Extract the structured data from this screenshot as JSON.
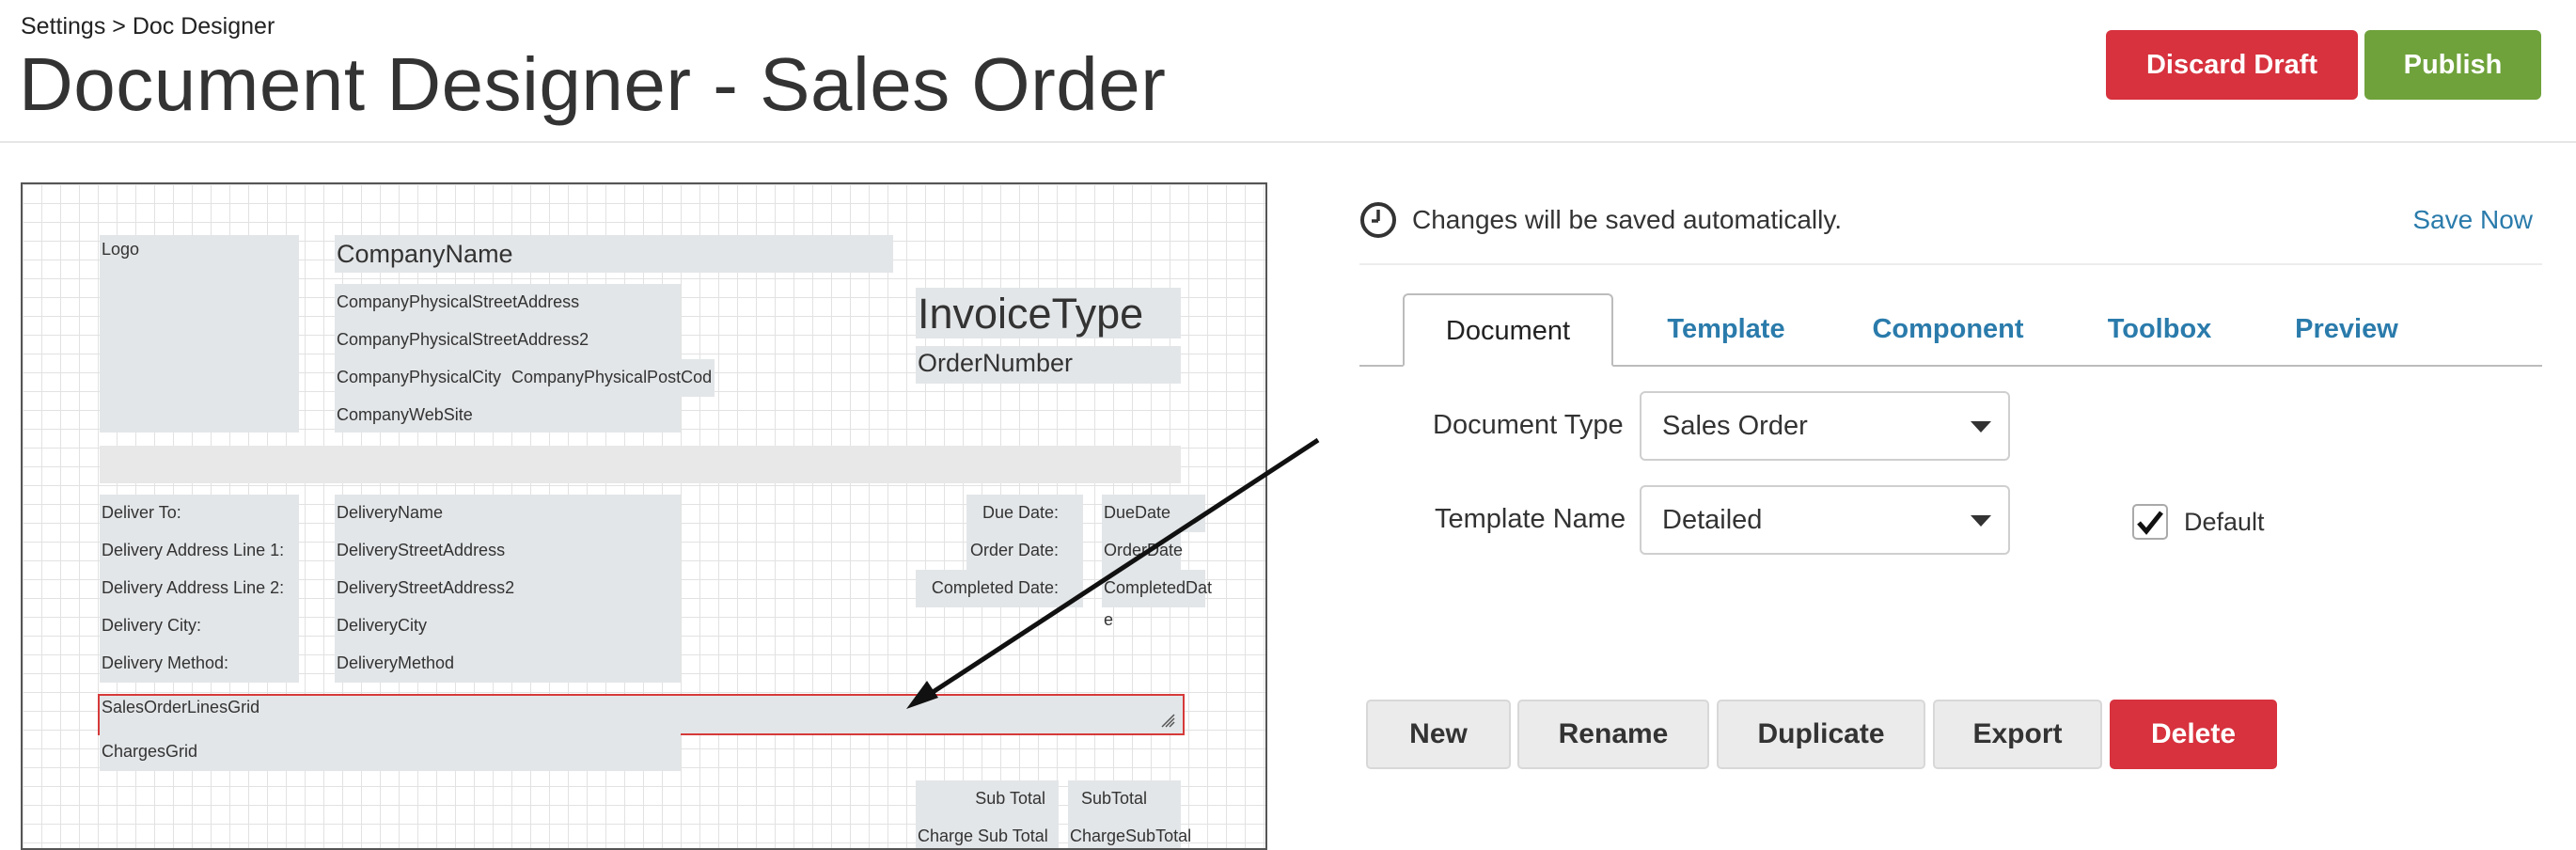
{
  "header": {
    "breadcrumb": "Settings > Doc Designer",
    "title": "Document Designer - Sales Order",
    "discard_label": "Discard Draft",
    "publish_label": "Publish"
  },
  "canvas": {
    "logo": "Logo",
    "company_name": "CompanyName",
    "street1": "CompanyPhysicalStreetAddress",
    "street2": "CompanyPhysicalStreetAddress2",
    "city": "CompanyPhysicalCity",
    "postcode": "CompanyPhysicalPostCod\ne",
    "website": "CompanyWebSite",
    "invoice_type": "InvoiceType",
    "order_number": "OrderNumber",
    "deliver_to": "Deliver To:",
    "addr_line1": "Delivery Address Line 1:",
    "addr_line2": "Delivery Address Line 2:",
    "delivery_city_label": "Delivery City:",
    "delivery_method_label": "Delivery Method:",
    "delivery_name": "DeliveryName",
    "delivery_street": "DeliveryStreetAddress",
    "delivery_street2": "DeliveryStreetAddress2",
    "delivery_city": "DeliveryCity",
    "delivery_method": "DeliveryMethod",
    "due_date_label": "Due Date:",
    "order_date_label": "Order Date:",
    "completed_date_label": "Completed Date:",
    "due_date": "DueDate",
    "order_date": "OrderDate",
    "completed_date": "CompletedDat\ne",
    "lines_grid": "SalesOrderLinesGrid",
    "charges_grid": "ChargesGrid",
    "sub_total_label": "Sub Total",
    "sub_total": "SubTotal",
    "charge_sub_total_label": "Charge Sub Total",
    "charge_sub_total": "ChargeSubTotal"
  },
  "panel": {
    "autosave_text": "Changes will be saved automatically.",
    "save_now": "Save Now",
    "tabs": [
      "Document",
      "Template",
      "Component",
      "Toolbox",
      "Preview"
    ],
    "active_tab": "Document",
    "document_type_label": "Document Type",
    "document_type_value": "Sales Order",
    "template_name_label": "Template Name",
    "template_name_value": "Detailed",
    "default_label": "Default",
    "default_checked": true,
    "actions": [
      "New",
      "Rename",
      "Duplicate",
      "Export",
      "Delete"
    ]
  },
  "colors": {
    "danger": "#d7323e",
    "success": "#6fa23b",
    "link": "#2a7bab"
  }
}
